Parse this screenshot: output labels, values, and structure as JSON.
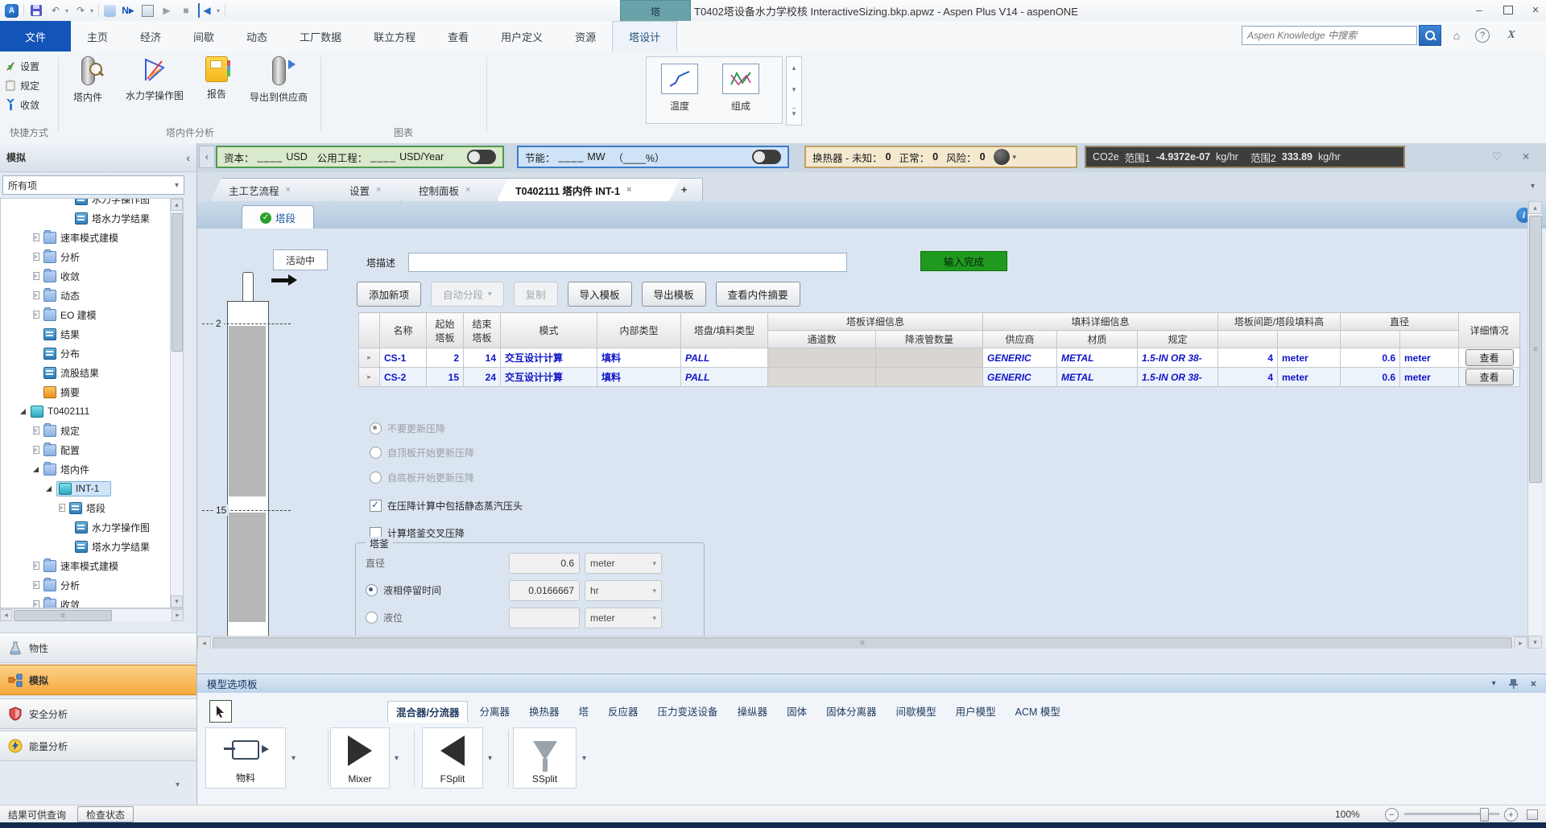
{
  "icons": {
    "caret_down": "▾",
    "caret_up": "▴",
    "caret_left": "◂",
    "caret_right": "▸",
    "chevron_left": "‹",
    "close": "×",
    "minimize": "–",
    "heart": "♡",
    "home": "⌂",
    "help": "?",
    "info": "i",
    "check": "✓",
    "grip": "≡",
    "play": "▶",
    "stop": "■",
    "step": "◀",
    "undo": "↶",
    "redo": "↷",
    "exchange": "X",
    "plus": "+"
  },
  "titlebar": {
    "title": "T0402塔设备水力学校核 InteractiveSizing.bkp.apwz - Aspen Plus V14 - aspenONE",
    "context_tab": "塔"
  },
  "ribbon": {
    "tabs": [
      "文件",
      "主页",
      "经济",
      "间歇",
      "动态",
      "工厂数据",
      "联立方程",
      "查看",
      "用户定义",
      "资源",
      "塔设计"
    ],
    "search_placeholder": "Aspen Knowledge 中搜索",
    "groups": {
      "shortcuts": {
        "label": "快捷方式",
        "items": [
          "设置",
          "规定",
          "收敛"
        ]
      },
      "internals": {
        "label": "塔内件分析",
        "items": [
          "塔内件",
          "水力学操作图",
          "报告",
          "导出到供应商"
        ]
      },
      "charts": {
        "label": "图表",
        "items": [
          "温度",
          "组成"
        ]
      }
    }
  },
  "energy": {
    "capital": {
      "l1": "资本：",
      "b1": "____",
      "u1": "USD",
      "l2": "公用工程：",
      "b2": "____",
      "u2": "USD/Year"
    },
    "savings": {
      "l1": "节能：",
      "b1": "____",
      "u1": "MW",
      "rest": "（____%）"
    },
    "hx": {
      "t": "换热器 -",
      "l1": "未知：",
      "v1": "0",
      "l2": "正常：",
      "v2": "0",
      "l3": "风险：",
      "v3": "0"
    },
    "co2": {
      "t": "CO2e",
      "l1": "范围1",
      "v1": "-4.9372e-07",
      "u1": "kg/hr",
      "l2": "范围2",
      "v2": "333.89",
      "u2": "kg/hr"
    }
  },
  "doctabs": {
    "items": [
      "主工艺流程",
      "设置",
      "控制面板",
      "T0402111 塔内件 INT-1"
    ]
  },
  "sidebar": {
    "header": "模拟",
    "filter": "所有项",
    "tree": [
      {
        "label": "水力学操作图"
      },
      {
        "label": "塔水力学结果"
      },
      {
        "label": "速率模式建模"
      },
      {
        "label": "分析"
      },
      {
        "label": "收敛"
      },
      {
        "label": "动态"
      },
      {
        "label": "EO 建模"
      },
      {
        "label": "结果"
      },
      {
        "label": "分布"
      },
      {
        "label": "流股结果"
      },
      {
        "label": "摘要"
      },
      {
        "label": "T0402111"
      },
      {
        "label": "规定"
      },
      {
        "label": "配置"
      },
      {
        "label": "塔内件"
      },
      {
        "label": "INT-1"
      },
      {
        "label": "塔段"
      },
      {
        "label": "水力学操作图"
      },
      {
        "label": "塔水力学结果"
      },
      {
        "label": "速率模式建模"
      },
      {
        "label": "分析"
      },
      {
        "label": "收敛"
      }
    ],
    "nav": [
      "物性",
      "模拟",
      "安全分析",
      "能量分析"
    ]
  },
  "form": {
    "tab": "塔段",
    "status": "活动中",
    "desc_label": "塔描述",
    "complete": "输入完成",
    "buttons": [
      "添加新项",
      "自动分段",
      "复制",
      "导入模板",
      "导出模板",
      "查看内件摘要"
    ],
    "tower": {
      "top": "2",
      "bottom": "15"
    },
    "table": {
      "h": {
        "name": "名称",
        "start": "起始塔板",
        "end": "结束塔板",
        "mode": "模式",
        "itype": "内部类型",
        "ptype": "塔盘/填料类型",
        "tray": "塔板详细信息",
        "ch": "通道数",
        "dc": "降液管数量",
        "pack": "填料详细信息",
        "vendor": "供应商",
        "mat": "材质",
        "spec": "规定",
        "sp": "塔板间距/塔段填料高",
        "dia": "直径",
        "det": "详细情况"
      },
      "rows": [
        {
          "name": "CS-1",
          "start": "2",
          "end": "14",
          "mode": "交互设计计算",
          "itype": "填料",
          "ptype": "PALL",
          "vendor": "GENERIC",
          "mat": "METAL",
          "spec": "1.5-IN OR 38-",
          "sp": "4",
          "spu": "meter",
          "dia": "0.6",
          "diau": "meter",
          "btn": "查看"
        },
        {
          "name": "CS-2",
          "start": "15",
          "end": "24",
          "mode": "交互设计计算",
          "itype": "填料",
          "ptype": "PALL",
          "vendor": "GENERIC",
          "mat": "METAL",
          "spec": "1.5-IN OR 38-",
          "sp": "4",
          "spu": "meter",
          "dia": "0.6",
          "diau": "meter",
          "btn": "查看"
        }
      ]
    },
    "radios": [
      "不要更新压降",
      "自顶板开始更新压降",
      "自底板开始更新压降"
    ],
    "checks": [
      "在压降计算中包括静态蒸汽压头",
      "计算塔釜交叉压降"
    ],
    "sump": {
      "legend": "塔釜",
      "rows": [
        {
          "label": "直径",
          "value": "0.6",
          "unit": "meter"
        },
        {
          "label": "液相停留时间",
          "value": "0.0166667",
          "unit": "hr"
        },
        {
          "label": "液位",
          "value": "",
          "unit": "meter"
        }
      ]
    }
  },
  "palette": {
    "title": "模型选项板",
    "tabs": [
      "混合器/分流器",
      "分离器",
      "换热器",
      "塔",
      "反应器",
      "压力变送设备",
      "操纵器",
      "固体",
      "固体分离器",
      "间歇模型",
      "用户模型",
      "ACM 模型"
    ],
    "items": [
      "物料",
      "Mixer",
      "FSplit",
      "SSplit"
    ]
  },
  "status": {
    "results": "结果可供查询",
    "check": "检查状态",
    "zoom": "100%"
  }
}
